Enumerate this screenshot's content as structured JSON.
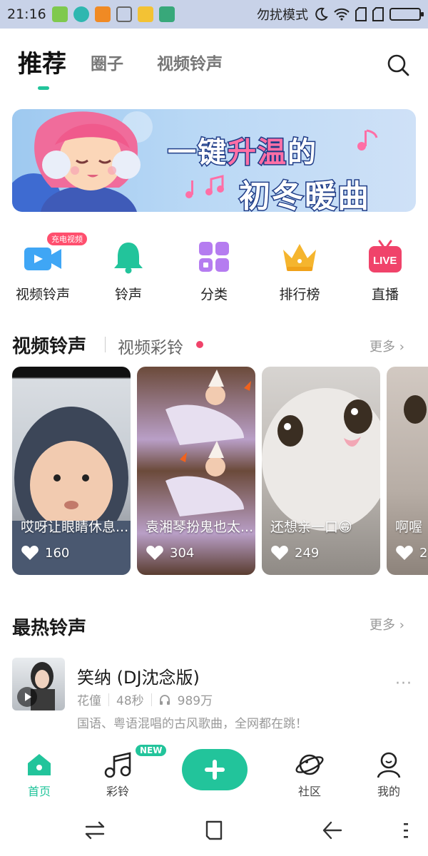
{
  "status_bar": {
    "time": "21:16",
    "dnd_label": "勿扰模式",
    "icons": [
      "notification-icon",
      "app-icon",
      "warning-icon",
      "clean-icon",
      "folder-icon",
      "usb-icon"
    ]
  },
  "header": {
    "tabs": [
      {
        "label": "推荐",
        "active": true
      },
      {
        "label": "圈子",
        "active": false
      },
      {
        "label": "视频铃声",
        "active": false
      }
    ],
    "accent_color": "#22c49b"
  },
  "banner": {
    "line1_a": "一键",
    "line1_b": "升温",
    "line1_c": "的",
    "line2": "初冬暖曲"
  },
  "quick_nav": {
    "items": [
      {
        "label": "视频铃声",
        "icon": "video-icon",
        "badge": "充电视频"
      },
      {
        "label": "铃声",
        "icon": "bell-icon"
      },
      {
        "label": "分类",
        "icon": "category-icon"
      },
      {
        "label": "排行榜",
        "icon": "crown-icon"
      },
      {
        "label": "直播",
        "icon": "live-tv-icon",
        "icon_text": "LIVE"
      }
    ]
  },
  "video_section": {
    "title": "视频铃声",
    "subtitle": "视频彩铃",
    "more": "更多",
    "cards": [
      {
        "title": "哎呀让眼睛休息...",
        "likes": "160"
      },
      {
        "title": "袁湘琴扮鬼也太...",
        "likes": "304"
      },
      {
        "title": "还想亲一口😁",
        "likes": "249"
      },
      {
        "title": "啊喔",
        "likes": "2"
      }
    ]
  },
  "hot_section": {
    "title": "最热铃声",
    "more": "更多",
    "song": {
      "title": "笑纳 (DJ沈念版)",
      "artist": "花僮",
      "duration": "48秒",
      "plays": "989万",
      "desc": "国语、粤语混唱的古风歌曲，全网都在跳！"
    }
  },
  "bottom_nav": {
    "items": [
      {
        "label": "首页",
        "icon": "home-icon",
        "active": true
      },
      {
        "label": "彩铃",
        "icon": "music-note-icon",
        "badge": "NEW"
      },
      {
        "label": "社区",
        "icon": "planet-icon"
      },
      {
        "label": "我的",
        "icon": "profile-icon"
      }
    ]
  }
}
